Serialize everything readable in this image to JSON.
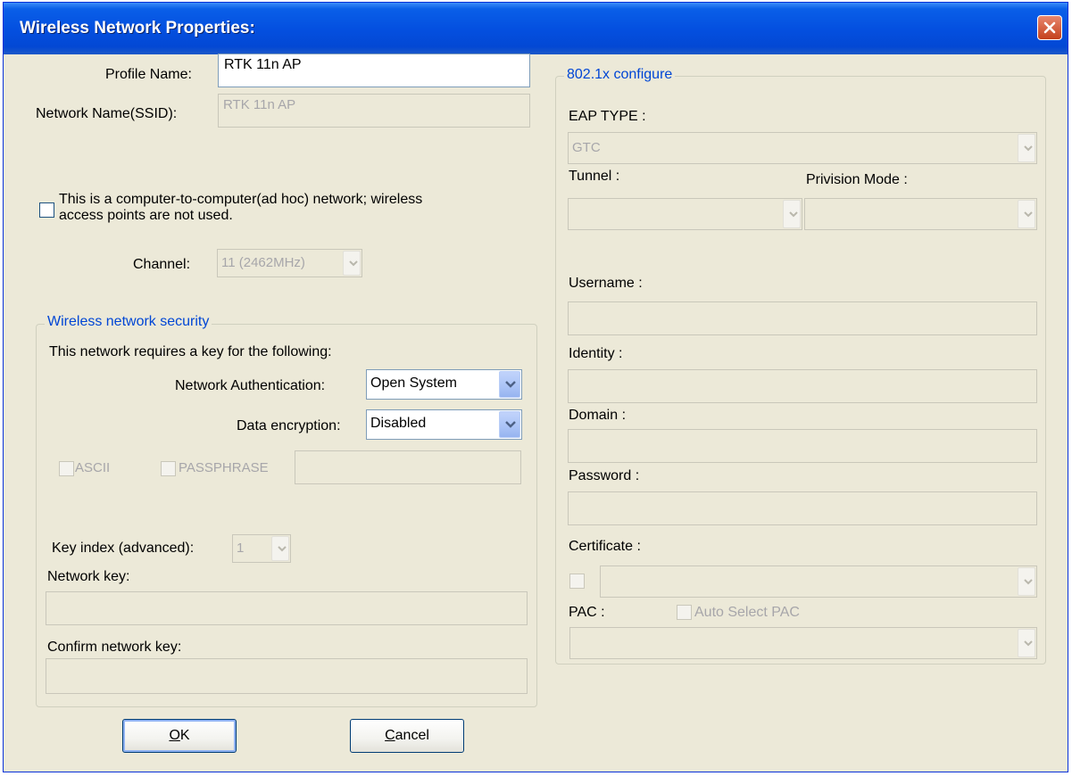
{
  "window": {
    "title": "Wireless Network Properties:"
  },
  "profile": {
    "profile_name_label": "Profile Name:",
    "profile_name_value": "RTK 11n AP",
    "ssid_label": "Network Name(SSID):",
    "ssid_value": "RTK 11n AP",
    "adhoc_label_line1": "This is a computer-to-computer(ad hoc) network; wireless",
    "adhoc_label_line2": "access points are not used.",
    "channel_label": "Channel:",
    "channel_value": "11 (2462MHz)"
  },
  "security": {
    "group_title": "Wireless network security",
    "requires_label": "This network requires a key for the following:",
    "auth_label": "Network Authentication:",
    "auth_value": "Open System",
    "encryption_label": "Data encryption:",
    "encryption_value": "Disabled",
    "ascii_label": "ASCII",
    "passphrase_label": "PASSPHRASE",
    "key_index_label": "Key index (advanced):",
    "key_index_value": "1",
    "network_key_label": "Network key:",
    "confirm_key_label": "Confirm network key:"
  },
  "eap": {
    "group_title": "802.1x configure",
    "eap_type_label": "EAP TYPE :",
    "eap_type_value": "GTC",
    "tunnel_label": "Tunnel :",
    "provision_label": "Privision Mode :",
    "username_label": "Username :",
    "identity_label": "Identity :",
    "domain_label": "Domain :",
    "password_label": "Password :",
    "certificate_label": "Certificate :",
    "pac_label": "PAC :",
    "auto_pac_label": "Auto Select PAC"
  },
  "buttons": {
    "ok_underline": "O",
    "ok_rest": "K",
    "cancel_underline": "C",
    "cancel_rest": "ancel"
  }
}
